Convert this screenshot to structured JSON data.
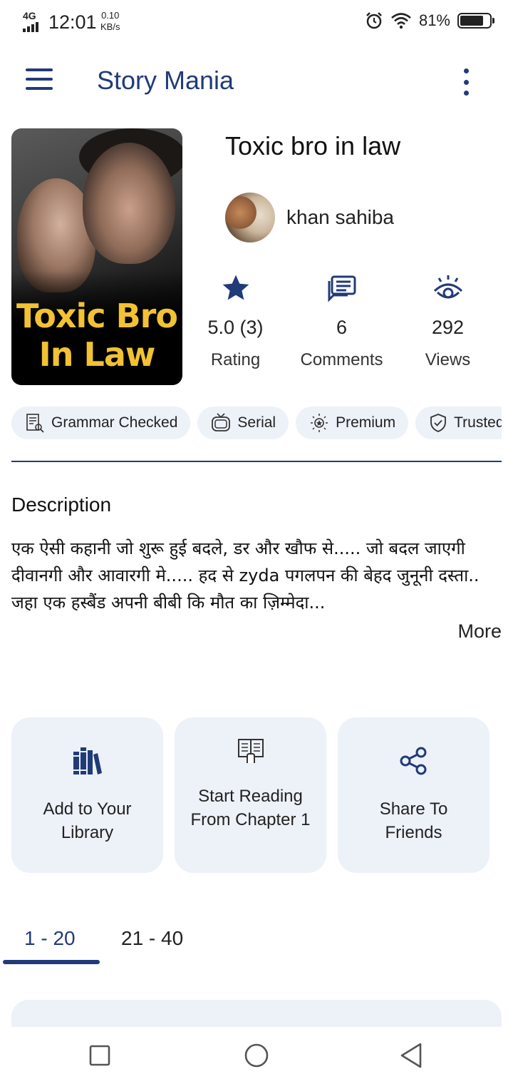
{
  "status_bar": {
    "network": "4G",
    "time": "12:01",
    "speed_value": "0.10",
    "speed_unit": "KB/s",
    "battery_percent": "81%",
    "battery_level": 0.81
  },
  "app_bar": {
    "title": "Story Mania"
  },
  "story": {
    "cover_title": "Toxic Bro In Law",
    "title": "Toxic bro in law",
    "author": "khan sahiba",
    "stats": [
      {
        "icon": "star-icon",
        "value": "5.0 (3)",
        "label": "Rating"
      },
      {
        "icon": "comments-icon",
        "value": "6",
        "label": "Comments"
      },
      {
        "icon": "eye-icon",
        "value": "292",
        "label": "Views"
      }
    ]
  },
  "chips": [
    {
      "icon": "grammar-check-icon",
      "label": "Grammar Checked"
    },
    {
      "icon": "serial-tv-icon",
      "label": "Serial"
    },
    {
      "icon": "premium-icon",
      "label": "Premium"
    },
    {
      "icon": "shield-check-icon",
      "label": "Trusted"
    }
  ],
  "description": {
    "heading": "Description",
    "text": "एक ऐसी कहानी जो शुरू हुई बदले, डर और खौफ से..... जो बदल जाएगी  दीवानगी और आवारगी मे..... हद से zyda पगलपन की बेहद जुनूनी दस्ता.. जहा एक हस्बैंड अपनी बीबी कि मौत का ज़िम्मेदा...",
    "more_label": "More"
  },
  "actions": [
    {
      "icon": "library-books-icon",
      "label": "Add to Your Library"
    },
    {
      "icon": "book-reading-icon",
      "label": "Start Reading From Chapter 1"
    },
    {
      "icon": "share-icon",
      "label": "Share To Friends"
    }
  ],
  "chapter_tabs": [
    {
      "label": "1 - 20",
      "active": true
    },
    {
      "label": "21 - 40",
      "active": false
    }
  ],
  "colors": {
    "accent": "#213b78",
    "card_bg": "#edf1f8",
    "cover_title": "#f2c232"
  },
  "nav_bar": {
    "buttons": [
      "recents-square-icon",
      "home-circle-icon",
      "back-triangle-icon"
    ]
  }
}
